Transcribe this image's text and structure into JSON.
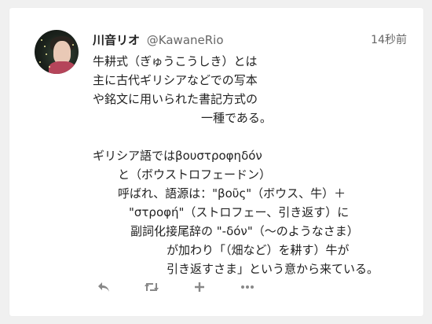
{
  "tweet": {
    "author_name": "川音リオ",
    "author_handle": "@KawaneRio",
    "timestamp": "14秒前",
    "lines": [
      "牛耕式（ぎゅうこうしき）とは",
      "主に古代ギリシアなどでの写本",
      "や銘文に用いられた書記方式の",
      "一種である。",
      "ギリシア語ではβουστροφηδόν",
      "と（ボウストロフェードン）",
      "呼ばれ、語源は：\"βοῦς\"（ボウス、牛）＋",
      "\"στροφή\"（ストロフェー、引き返す）に",
      "副詞化接尾辞の \"-δόν\"（〜のようなさま）",
      "が加わり「（畑など）を耕す）牛が",
      "引き返すさま」という意から来ている。"
    ]
  },
  "actions": {
    "reply_icon": "reply-arrow",
    "retweet_icon": "retweet-arrows",
    "like_icon": "plus",
    "more_icon": "ellipsis"
  },
  "colors": {
    "background": "#f0f0f0",
    "card": "#ffffff",
    "text": "#222222",
    "muted": "#666666",
    "action_icon": "#888888"
  }
}
